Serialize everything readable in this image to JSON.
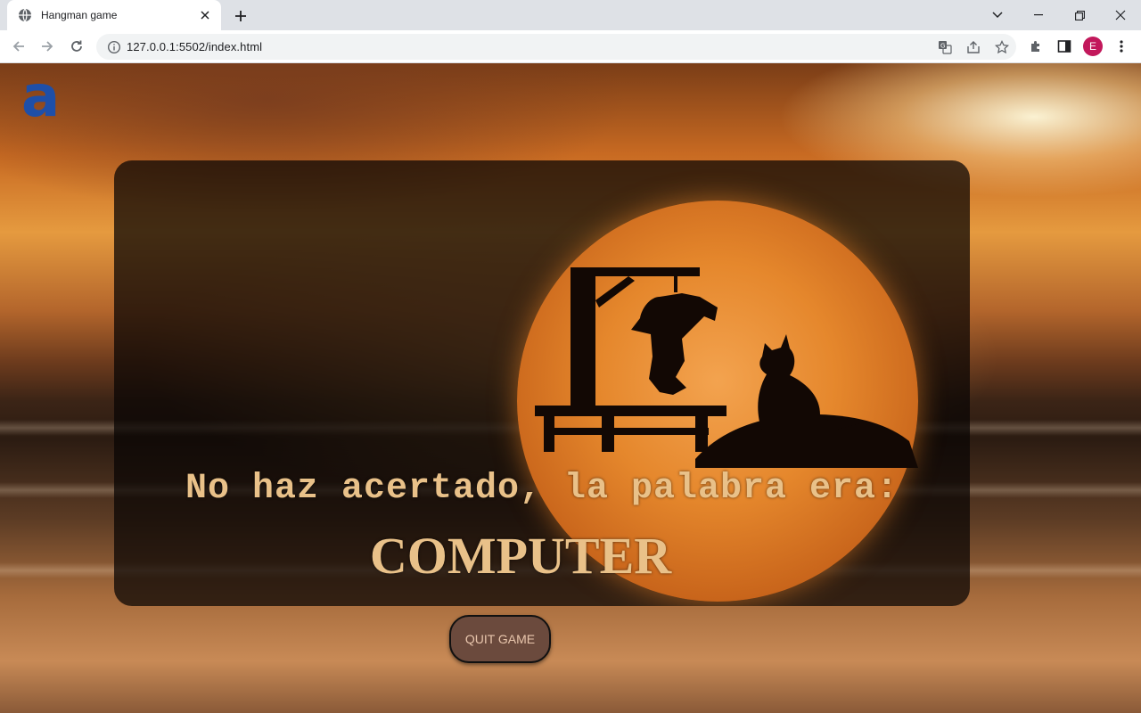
{
  "browser": {
    "tab_title": "Hangman game",
    "url": "127.0.0.1:5502/index.html",
    "profile_initial": "E"
  },
  "page": {
    "logo_text": "a",
    "message": "No haz acertado, la palabra era:",
    "word": "COMPUTER",
    "quit_label": "QUIT GAME"
  },
  "colors": {
    "text_accent": "#e9c189",
    "logo": "#1e4fa8",
    "button_bg": "#6b4a3d",
    "moon": "#e5872c",
    "avatar": "#c2185b"
  }
}
